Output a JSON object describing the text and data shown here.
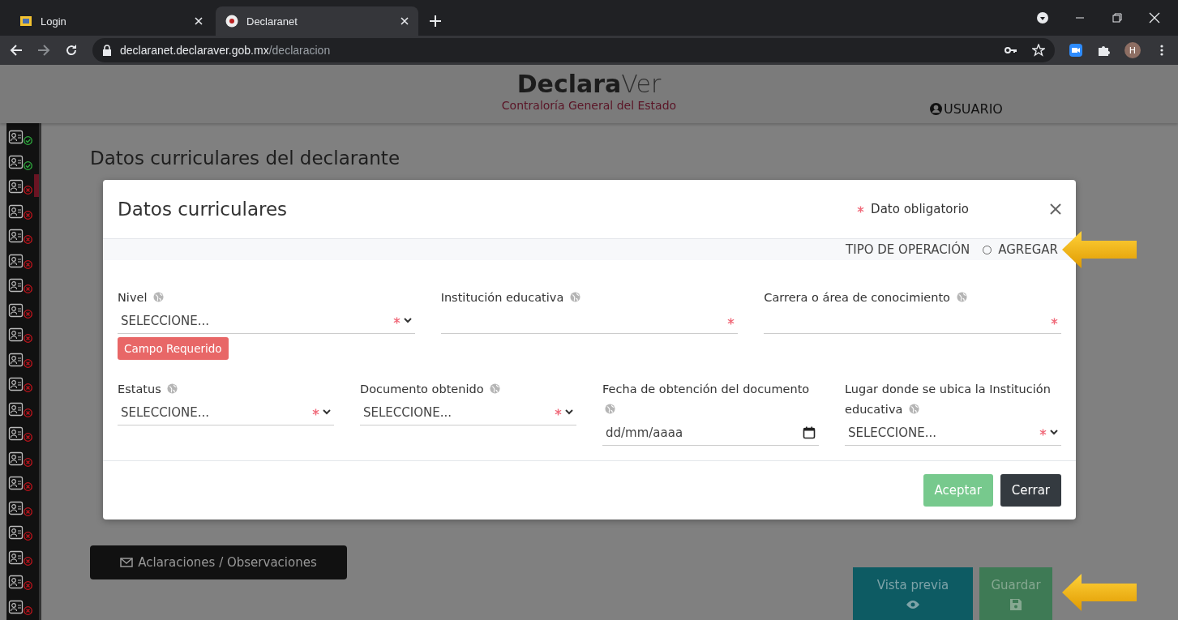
{
  "browser": {
    "tabs": [
      {
        "title": "Login",
        "selected": false
      },
      {
        "title": "Declaranet",
        "selected": true
      }
    ],
    "url": {
      "host": "declaranet.declaraver.gob.mx",
      "path": "/declaracion"
    },
    "profile_initial": "H"
  },
  "header": {
    "logo_bold": "Declara",
    "logo_light": "Ver",
    "subtitle": "Contraloría General del Estado",
    "user": "USUARIO"
  },
  "sidebar": {
    "items": [
      {
        "complete": true,
        "selected": false
      },
      {
        "complete": true,
        "selected": false
      },
      {
        "complete": false,
        "selected": true
      },
      {
        "complete": false,
        "selected": false
      },
      {
        "complete": false,
        "selected": false
      },
      {
        "complete": false,
        "selected": false
      },
      {
        "complete": false,
        "selected": false
      },
      {
        "complete": false,
        "selected": false
      },
      {
        "complete": false,
        "selected": false
      },
      {
        "complete": false,
        "selected": false
      },
      {
        "complete": false,
        "selected": false
      },
      {
        "complete": false,
        "selected": false
      },
      {
        "complete": false,
        "selected": false
      },
      {
        "complete": false,
        "selected": false
      },
      {
        "complete": false,
        "selected": false
      },
      {
        "complete": false,
        "selected": false
      },
      {
        "complete": false,
        "selected": false
      },
      {
        "complete": false,
        "selected": false
      },
      {
        "complete": false,
        "selected": false
      },
      {
        "complete": false,
        "selected": false
      }
    ]
  },
  "page": {
    "title": "Datos curriculares del declarante",
    "clarifications_button": "Aclaraciones / Observaciones",
    "preview_button": "Vista previa",
    "save_button": "Guardar"
  },
  "modal": {
    "title": "Datos curriculares",
    "required_note": "Dato obligatorio",
    "operation_label": "TIPO DE OPERACIÓN",
    "operation_option": {
      "label": "AGREGAR",
      "selected": false
    },
    "rows": [
      [
        {
          "kind": "select",
          "label": "Nivel",
          "value": "SELECCIONE...",
          "required": true,
          "error": "Campo Requerido"
        },
        {
          "kind": "text",
          "label": "Institución educativa",
          "required": true
        },
        {
          "kind": "text",
          "label": "Carrera o área de conocimiento",
          "required": true
        }
      ],
      [
        {
          "kind": "select",
          "label": "Estatus",
          "value": "SELECCIONE...",
          "required": true
        },
        {
          "kind": "select",
          "label": "Documento obtenido",
          "value": "SELECCIONE...",
          "required": true
        },
        {
          "kind": "date",
          "label": "Fecha de obtención del documento",
          "placeholder": "dd/mm/aaaa",
          "required": false
        },
        {
          "kind": "select",
          "label": "Lugar donde se ubica la Institución educativa",
          "value": "SELECCIONE...",
          "required": true
        }
      ]
    ],
    "accept": "Aceptar",
    "close": "Cerrar"
  }
}
